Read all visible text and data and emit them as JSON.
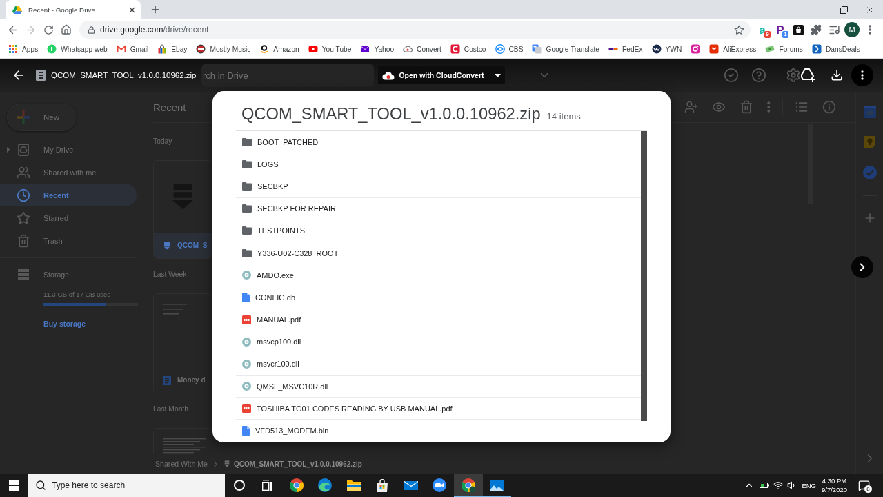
{
  "browser": {
    "tabs": [
      {
        "title": "Recent - Google Drive",
        "selected": true
      }
    ],
    "address": {
      "host": "drive.google.com",
      "path": "/drive/recent"
    },
    "extensions": [
      {
        "kind": "letter",
        "glyph": "a",
        "color": "#15b8a6",
        "badge": {
          "text": "9",
          "color": "#e94235"
        }
      },
      {
        "kind": "letter",
        "glyph": "P",
        "color": "#6a1b9a",
        "badge": {
          "text": "1",
          "color": "#4285f4"
        }
      },
      {
        "kind": "bag"
      },
      {
        "kind": "puzzle"
      },
      {
        "kind": "media"
      }
    ],
    "avatar": "M"
  },
  "bookmarks": [
    {
      "kind": "apps",
      "label": "Apps"
    },
    {
      "kind": "whatsapp",
      "label": "Whatsapp web"
    },
    {
      "kind": "gmail",
      "label": "Gmail"
    },
    {
      "kind": "ebay",
      "label": "Ebay"
    },
    {
      "kind": "music",
      "label": "Mostly Music"
    },
    {
      "kind": "amazon",
      "label": "Amazon"
    },
    {
      "kind": "youtube",
      "label": "You Tube"
    },
    {
      "kind": "yahoo",
      "label": "Yahoo"
    },
    {
      "kind": "cloud",
      "label": "Convert"
    },
    {
      "kind": "costco",
      "label": "Costco"
    },
    {
      "kind": "cbs",
      "label": "CBS"
    },
    {
      "kind": "translate",
      "label": "Google Translate"
    },
    {
      "kind": "fedex",
      "label": "FedEx"
    },
    {
      "kind": "ywn",
      "label": "YWN"
    },
    {
      "kind": "instagram"
    },
    {
      "kind": "aliexpress",
      "label": "AliExpress"
    },
    {
      "kind": "forums",
      "label": "Forums"
    },
    {
      "kind": "dansdeals",
      "label": "DansDeals"
    }
  ],
  "viewer": {
    "file_name": "QCOM_SMART_TOOL_v1.0.0.10962.zip",
    "open_with": "Open with CloudConvert"
  },
  "drive": {
    "search": {
      "placeholder": "rch in Drive"
    },
    "new_button": "New",
    "nav": [
      {
        "kind": "drive",
        "label": "My Drive",
        "selected": false,
        "expanded": false
      },
      {
        "kind": "shared",
        "label": "Shared with me",
        "selected": false
      },
      {
        "kind": "recent",
        "label": "Recent",
        "selected": true
      },
      {
        "kind": "starred",
        "label": "Starred",
        "selected": false
      },
      {
        "kind": "trash",
        "label": "Trash",
        "selected": false
      }
    ],
    "storage": {
      "label": "Storage",
      "usage": "11.3 GB of 17 GB used",
      "level": 0.66,
      "link": "Buy storage"
    },
    "title": "Recent",
    "sections": [
      {
        "title": "Today",
        "files": [
          {
            "kind": "zip",
            "name": "QCOM_S",
            "selected": true
          }
        ]
      },
      {
        "title": "Last Week",
        "files": [
          {
            "kind": "doc",
            "name": "Money d",
            "selected": false
          }
        ]
      },
      {
        "title": "Last Month",
        "files": [
          {
            "kind": "doc"
          }
        ]
      }
    ],
    "breadcrumb": [
      {
        "label": "Shared With Me"
      },
      {
        "kind": "zip",
        "label": "QCOM_SMART_TOOL_v1.0.0.10962.zip"
      }
    ]
  },
  "archive": {
    "title": "QCOM_SMART_TOOL_v1.0.0.10962.zip",
    "count": "14 items",
    "entries": [
      {
        "kind": "folder",
        "name": "BOOT_PATCHED"
      },
      {
        "kind": "folder",
        "name": "LOGS"
      },
      {
        "kind": "folder",
        "name": "SECBKP"
      },
      {
        "kind": "folder",
        "name": "SECBKP FOR REPAIR"
      },
      {
        "kind": "folder",
        "name": "TESTPOINTS"
      },
      {
        "kind": "folder",
        "name": "Y336-U02-C328_ROOT"
      },
      {
        "kind": "app",
        "name": "AMDO.exe"
      },
      {
        "kind": "doc",
        "name": "CONFIG.db"
      },
      {
        "kind": "pdf",
        "name": "MANUAL.pdf"
      },
      {
        "kind": "app",
        "name": "msvcp100.dll"
      },
      {
        "kind": "app",
        "name": "msvcr100.dll"
      },
      {
        "kind": "app",
        "name": "QMSL_MSVC10R.dll"
      },
      {
        "kind": "pdf",
        "name": "TOSHIBA TG01 CODES READING BY USB MANUAL.pdf"
      },
      {
        "kind": "doc",
        "name": "VFD513_MODEM.bin"
      }
    ]
  },
  "taskbar": {
    "search": {
      "placeholder": "Type here to search"
    },
    "apps": [
      {
        "kind": "cortana",
        "selected": false,
        "running": false
      },
      {
        "kind": "taskview",
        "selected": false,
        "running": false
      },
      {
        "kind": "chrome",
        "selected": false,
        "running": false
      },
      {
        "kind": "edge",
        "selected": false,
        "running": false
      },
      {
        "kind": "explorer",
        "selected": false,
        "running": false
      },
      {
        "kind": "store",
        "selected": false,
        "running": false
      },
      {
        "kind": "mail",
        "selected": false,
        "running": false
      },
      {
        "kind": "zoom",
        "selected": false,
        "running": false
      },
      {
        "kind": "chrome-profile",
        "selected": true,
        "running": true
      },
      {
        "kind": "photos",
        "selected": false,
        "running": true
      }
    ],
    "language": "ENG",
    "time": "4:30 PM",
    "date": "9/7/2020",
    "notifications": "8"
  }
}
